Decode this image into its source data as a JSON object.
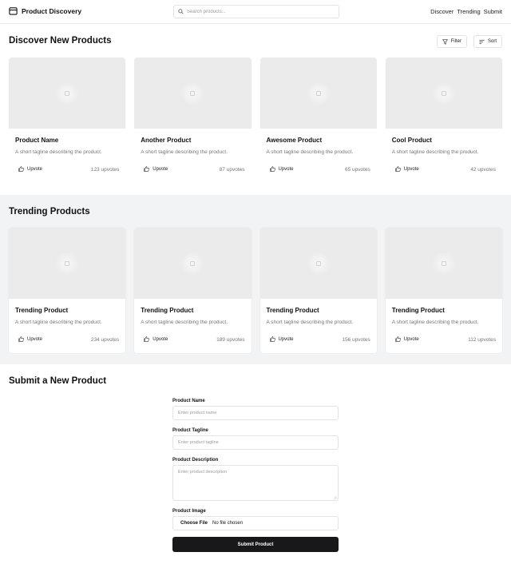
{
  "header": {
    "brand": "Product Discovery",
    "search_placeholder": "Search products...",
    "nav": [
      "Discover",
      "Trending",
      "Submit"
    ]
  },
  "discover": {
    "title": "Discover New Products",
    "filter_label": "Filter",
    "sort_label": "Sort",
    "products": [
      {
        "name": "Product Name",
        "tagline": "A short tagline describing the product.",
        "upvote_label": "Upvote",
        "votes": "123 upvotes"
      },
      {
        "name": "Another Product",
        "tagline": "A short tagline describing the product.",
        "upvote_label": "Upvote",
        "votes": "87 upvotes"
      },
      {
        "name": "Awesome Product",
        "tagline": "A short tagline describing the product.",
        "upvote_label": "Upvote",
        "votes": "65 upvotes"
      },
      {
        "name": "Cool Product",
        "tagline": "A short tagline describing the product.",
        "upvote_label": "Upvote",
        "votes": "42 upvotes"
      }
    ]
  },
  "trending": {
    "title": "Trending Products",
    "products": [
      {
        "name": "Trending Product",
        "tagline": "A short tagline describing the product.",
        "upvote_label": "Upvote",
        "votes": "234 upvotes"
      },
      {
        "name": "Trending Product",
        "tagline": "A short tagline describing the product.",
        "upvote_label": "Upvote",
        "votes": "189 upvotes"
      },
      {
        "name": "Trending Product",
        "tagline": "A short tagline describing the product.",
        "upvote_label": "Upvote",
        "votes": "156 upvotes"
      },
      {
        "name": "Trending Product",
        "tagline": "A short tagline describing the product.",
        "upvote_label": "Upvote",
        "votes": "112 upvotes"
      }
    ]
  },
  "submit": {
    "title": "Submit a New Product",
    "name_label": "Product Name",
    "name_placeholder": "Enter product name",
    "tagline_label": "Product Tagline",
    "tagline_placeholder": "Enter product tagline",
    "description_label": "Product Description",
    "description_placeholder": "Enter product description",
    "image_label": "Product Image",
    "file_button": "Choose File",
    "file_status": "No file chosen",
    "submit_label": "Submit Product"
  },
  "icons": {
    "brand": "box-icon",
    "search": "search-icon",
    "filter": "filter-icon",
    "sort": "sort-icon",
    "upvote": "thumbs-up-icon",
    "placeholder": "image-placeholder-icon"
  },
  "colors": {
    "primary_button": "#18181b",
    "trending_background": "#f2f3f5",
    "thumbnail": "#ebebeb"
  }
}
